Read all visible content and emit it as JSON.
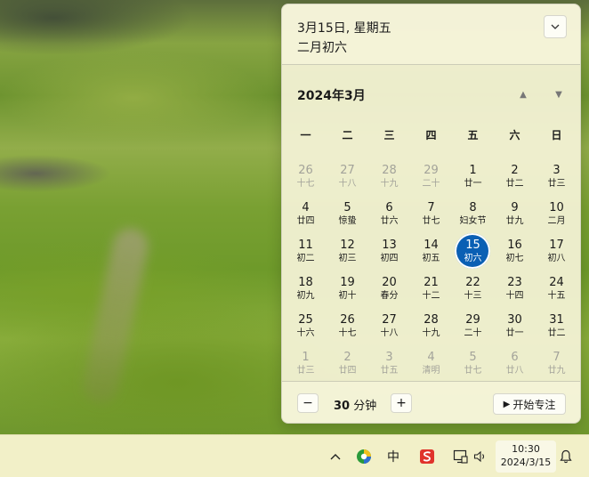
{
  "flyout": {
    "date_label": "3月15日, 星期五",
    "lunar_label": "二月初六",
    "month_title": "2024年3月",
    "weekdays": [
      "一",
      "二",
      "三",
      "四",
      "五",
      "六",
      "日"
    ],
    "days": [
      {
        "n": "26",
        "l": "十七",
        "other": true
      },
      {
        "n": "27",
        "l": "十八",
        "other": true
      },
      {
        "n": "28",
        "l": "十九",
        "other": true
      },
      {
        "n": "29",
        "l": "二十",
        "other": true
      },
      {
        "n": "1",
        "l": "廿一"
      },
      {
        "n": "2",
        "l": "廿二"
      },
      {
        "n": "3",
        "l": "廿三"
      },
      {
        "n": "4",
        "l": "廿四"
      },
      {
        "n": "5",
        "l": "惊蛰"
      },
      {
        "n": "6",
        "l": "廿六"
      },
      {
        "n": "7",
        "l": "廿七"
      },
      {
        "n": "8",
        "l": "妇女节"
      },
      {
        "n": "9",
        "l": "廿九"
      },
      {
        "n": "10",
        "l": "二月"
      },
      {
        "n": "11",
        "l": "初二"
      },
      {
        "n": "12",
        "l": "初三"
      },
      {
        "n": "13",
        "l": "初四"
      },
      {
        "n": "14",
        "l": "初五"
      },
      {
        "n": "15",
        "l": "初六",
        "selected": true
      },
      {
        "n": "16",
        "l": "初七"
      },
      {
        "n": "17",
        "l": "初八"
      },
      {
        "n": "18",
        "l": "初九"
      },
      {
        "n": "19",
        "l": "初十"
      },
      {
        "n": "20",
        "l": "春分"
      },
      {
        "n": "21",
        "l": "十二"
      },
      {
        "n": "22",
        "l": "十三"
      },
      {
        "n": "23",
        "l": "十四"
      },
      {
        "n": "24",
        "l": "十五"
      },
      {
        "n": "25",
        "l": "十六"
      },
      {
        "n": "26",
        "l": "十七"
      },
      {
        "n": "27",
        "l": "十八"
      },
      {
        "n": "28",
        "l": "十九"
      },
      {
        "n": "29",
        "l": "二十"
      },
      {
        "n": "30",
        "l": "廿一"
      },
      {
        "n": "31",
        "l": "廿二"
      },
      {
        "n": "1",
        "l": "廿三",
        "other": true
      },
      {
        "n": "2",
        "l": "廿四",
        "other": true
      },
      {
        "n": "3",
        "l": "廿五",
        "other": true
      },
      {
        "n": "4",
        "l": "清明",
        "other": true
      },
      {
        "n": "5",
        "l": "廿七",
        "other": true
      },
      {
        "n": "6",
        "l": "廿八",
        "other": true
      },
      {
        "n": "7",
        "l": "廿九",
        "other": true
      }
    ],
    "focus": {
      "minus_label": "−",
      "minutes": "30",
      "unit": "分钟",
      "plus_label": "+",
      "start_label": "开始专注"
    }
  },
  "taskbar": {
    "ime_label": "中",
    "time": "10:30",
    "date": "2024/3/15"
  },
  "colors": {
    "selected": "#0a5fb4",
    "muted_day": "#a3a39a",
    "ime_app_red": "#e0332b"
  },
  "icons": [
    "chevron-down-icon",
    "triangle-up-icon",
    "triangle-down-icon",
    "play-icon",
    "tray-chevron-up-icon",
    "app-icon",
    "ime-app-icon",
    "network-icon",
    "speaker-icon",
    "bell-icon"
  ]
}
